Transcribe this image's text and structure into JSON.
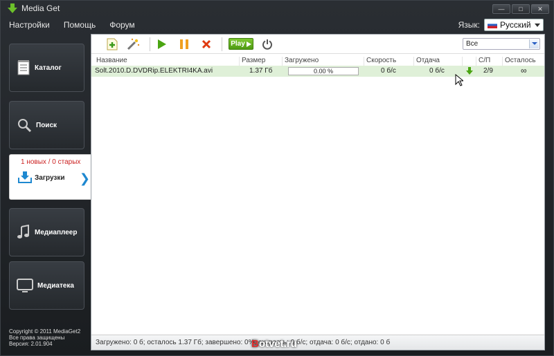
{
  "window": {
    "title": "Media Get"
  },
  "menu": {
    "items": [
      "Настройки",
      "Помощь",
      "Форум"
    ]
  },
  "language": {
    "label": "Язык:",
    "value": "Русский"
  },
  "sidebar": {
    "items": [
      {
        "label": "Каталог",
        "icon": "catalog-icon"
      },
      {
        "label": "Поиск",
        "icon": "search-icon"
      },
      {
        "label": "Загрузки",
        "icon": "download-tray-icon",
        "active": true,
        "new_count": "1 новых / 0 старых"
      },
      {
        "label": "Медиаплеер",
        "icon": "music-note-icon"
      },
      {
        "label": "Медиатека",
        "icon": "tv-icon"
      }
    ],
    "copyright": [
      "Copyright © 2011 MediaGet2",
      "Все права защищены",
      "Версия: 2.01.904"
    ]
  },
  "toolbar": {
    "play_label": "Play",
    "filter_value": "Все"
  },
  "table": {
    "columns": [
      "Название",
      "Размер",
      "Загружено",
      "Скорость",
      "Отдача",
      "С/П",
      "Осталось"
    ],
    "rows": [
      {
        "name": "Solt.2010.D.DVDRip.ELEKTRI4KA.avi",
        "size": "1.37 Гб",
        "progress": "0.00 %",
        "progress_value": 0,
        "speed": "0 б/с",
        "upload": "0 б/с",
        "peers": "2/9",
        "remaining": "∞"
      }
    ]
  },
  "statusbar": {
    "text": "Загружено: 0 б; осталось 1.37 Гб; завершено: 0%; скорость: 0 б/с; отдача: 0 б/с; отдано: 0 б"
  },
  "watermark": {
    "prefix": "B",
    "rest": "otvet.ru"
  },
  "colors": {
    "accent": "#1e88d0",
    "new_count": "#cc2222",
    "row_highlight": "#dff0d8",
    "play_green": "#5aa81a"
  }
}
